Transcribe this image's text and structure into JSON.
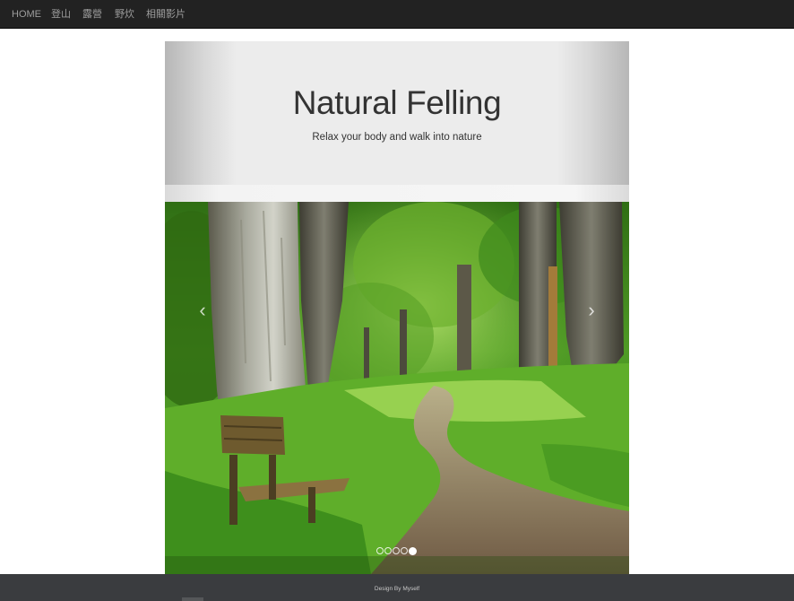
{
  "navbar": {
    "items": [
      {
        "label": "HOME"
      },
      {
        "label": "登山"
      },
      {
        "label": "露營"
      },
      {
        "label": "野炊"
      },
      {
        "label": "相關影片"
      }
    ]
  },
  "jumbotron": {
    "title": "Natural Felling",
    "subtitle": "Relax your body and walk into nature"
  },
  "carousel": {
    "prev_glyph": "‹",
    "next_glyph": "›",
    "slide_count": 5,
    "active_index": 4
  },
  "footer": {
    "text": "Design By Myself"
  },
  "colors": {
    "navbar_bg": "#222222",
    "nav_text": "#9d9d9d",
    "footer_bg": "#3a3c3f"
  }
}
